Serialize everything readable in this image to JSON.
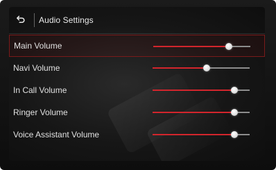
{
  "header": {
    "back_icon": "back-arrow-icon",
    "title": "Audio Settings"
  },
  "volume_rows": [
    {
      "label": "Main Volume",
      "level": 0.78,
      "selected": true
    },
    {
      "label": "Navi Volume",
      "level": 0.56,
      "selected": false
    },
    {
      "label": "In Call Volume",
      "level": 0.84,
      "selected": false
    },
    {
      "label": "Ringer Volume",
      "level": 0.84,
      "selected": false
    },
    {
      "label": "Voice Assistant Volume",
      "level": 0.84,
      "selected": false
    }
  ],
  "colors": {
    "accent": "#d2252c",
    "track": "#8c8c8c",
    "selection_border": "#7a1a1a"
  }
}
